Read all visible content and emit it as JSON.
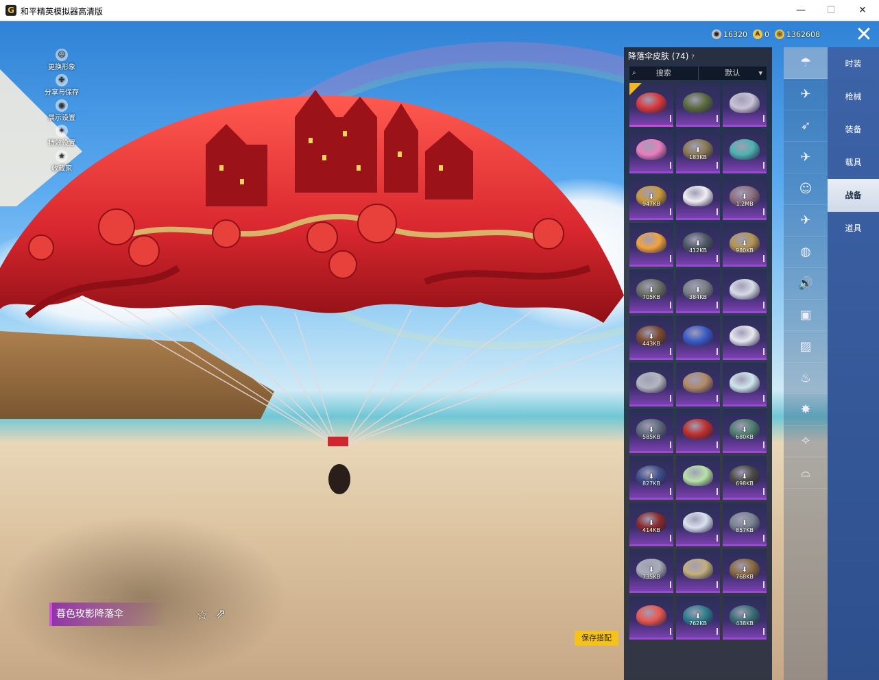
{
  "window": {
    "title": "和平精英模拟器高清版",
    "logo_glyph": "G",
    "minimize": "—",
    "maximize": "☐",
    "close": "✕"
  },
  "currency": [
    {
      "name": "silver-coin",
      "value": "16320",
      "color": "#c8c8c8",
      "glyph": "◉"
    },
    {
      "name": "a-coin",
      "value": "0",
      "color": "#f2c94c",
      "glyph": "A"
    },
    {
      "name": "gold-coin",
      "value": "1362608",
      "color": "#e8c14a",
      "glyph": "◎"
    }
  ],
  "close_button": "✕",
  "left_menu": [
    {
      "label": "更换形象",
      "icon": "person-icon",
      "glyph": "☺"
    },
    {
      "label": "分享与保存",
      "icon": "share-icon",
      "glyph": "✚"
    },
    {
      "label": "展示设置",
      "icon": "eye-icon",
      "glyph": "◉"
    },
    {
      "label": "特效设置",
      "icon": "flame-icon",
      "glyph": "✦"
    },
    {
      "label": "收藏家",
      "icon": "trophy-icon",
      "glyph": "★"
    }
  ],
  "panel": {
    "title": "降落伞皮肤 (74)",
    "help": "?",
    "search_label": "搜索",
    "sort_label": "默认",
    "sort_arrow": "▾",
    "search_glyph": "⌕",
    "tiles": [
      {
        "size": "",
        "selected": true,
        "color": "#d83a3a"
      },
      {
        "size": "",
        "selected": false,
        "color": "#5a6b3c"
      },
      {
        "size": "",
        "selected": false,
        "color": "#c9c3d6"
      },
      {
        "size": "",
        "selected": false,
        "color": "#e77fbd"
      },
      {
        "size": "183KB",
        "selected": false,
        "color": "#8a7a52"
      },
      {
        "size": "",
        "selected": false,
        "color": "#4db3b0"
      },
      {
        "size": "947KB",
        "selected": false,
        "color": "#c99a3a"
      },
      {
        "size": "",
        "selected": false,
        "color": "#f1eef3"
      },
      {
        "size": "1.2MB",
        "selected": false,
        "color": "#8c6f7f"
      },
      {
        "size": "",
        "selected": false,
        "color": "#f2a33c"
      },
      {
        "size": "412KB",
        "selected": false,
        "color": "#4f5963"
      },
      {
        "size": "980KB",
        "selected": false,
        "color": "#b39552"
      },
      {
        "size": "705KB",
        "selected": false,
        "color": "#6a6f63"
      },
      {
        "size": "384KB",
        "selected": false,
        "color": "#7a7f84"
      },
      {
        "size": "",
        "selected": false,
        "color": "#d7dbe6"
      },
      {
        "size": "443KB",
        "selected": false,
        "color": "#7b4a2e"
      },
      {
        "size": "",
        "selected": false,
        "color": "#3a5cc6"
      },
      {
        "size": "",
        "selected": false,
        "color": "#e6e8f0"
      },
      {
        "size": "",
        "selected": false,
        "color": "#b3b7bf"
      },
      {
        "size": "",
        "selected": false,
        "color": "#b08a66"
      },
      {
        "size": "",
        "selected": false,
        "color": "#cfe6ec"
      },
      {
        "size": "585KB",
        "selected": false,
        "color": "#616a7d"
      },
      {
        "size": "",
        "selected": false,
        "color": "#c0302a"
      },
      {
        "size": "680KB",
        "selected": false,
        "color": "#4f7e6e"
      },
      {
        "size": "827KB",
        "selected": false,
        "color": "#3f4f8a"
      },
      {
        "size": "",
        "selected": false,
        "color": "#b8e3a7"
      },
      {
        "size": "698KB",
        "selected": false,
        "color": "#4b4a44"
      },
      {
        "size": "414KB",
        "selected": false,
        "color": "#8b2b2a"
      },
      {
        "size": "",
        "selected": false,
        "color": "#d9e2ee"
      },
      {
        "size": "857KB",
        "selected": false,
        "color": "#7a8590"
      },
      {
        "size": "735KB",
        "selected": false,
        "color": "#a8adb6"
      },
      {
        "size": "",
        "selected": false,
        "color": "#c2b07c"
      },
      {
        "size": "768KB",
        "selected": false,
        "color": "#8a6a3f"
      },
      {
        "size": "",
        "selected": false,
        "color": "#e9594f"
      },
      {
        "size": "762KB",
        "selected": false,
        "color": "#2d7f8c"
      },
      {
        "size": "438KB",
        "selected": false,
        "color": "#3b6f74"
      }
    ]
  },
  "categories": [
    {
      "icon": "parachute-icon",
      "glyph": "☂",
      "active": true
    },
    {
      "icon": "glider-icon",
      "glyph": "✈"
    },
    {
      "icon": "plane-icon",
      "glyph": "➶"
    },
    {
      "icon": "jet-icon",
      "glyph": "✈"
    },
    {
      "icon": "emote-icon",
      "glyph": "☺"
    },
    {
      "icon": "aircraft-icon",
      "glyph": "✈"
    },
    {
      "icon": "pumpkin-icon",
      "glyph": "◍"
    },
    {
      "icon": "sound-icon",
      "glyph": "🔊"
    },
    {
      "icon": "badge-icon",
      "glyph": "▣"
    },
    {
      "icon": "photo-icon",
      "glyph": "▨"
    },
    {
      "icon": "spray-icon",
      "glyph": "♨"
    },
    {
      "icon": "sparkle-icon",
      "glyph": "✸"
    },
    {
      "icon": "wand-icon",
      "glyph": "✧"
    },
    {
      "icon": "helmet-icon",
      "glyph": "⌓"
    }
  ],
  "tabs": [
    {
      "label": "时装",
      "active": false
    },
    {
      "label": "枪械",
      "active": false
    },
    {
      "label": "装备",
      "active": false
    },
    {
      "label": "载具",
      "active": false
    },
    {
      "label": "战备",
      "active": true
    },
    {
      "label": "道具",
      "active": false
    }
  ],
  "item_name": "暮色玫影降落伞",
  "favorite_glyph": "☆",
  "share_glyph": "⇗",
  "save_button": "保存搭配",
  "colors": {
    "canopy": "#d8262e",
    "canopy_dark": "#8e1016",
    "gold_trim": "#d9b36a",
    "accent_yellow": "#f3c21d",
    "tab_blue": "#3d63a8"
  }
}
